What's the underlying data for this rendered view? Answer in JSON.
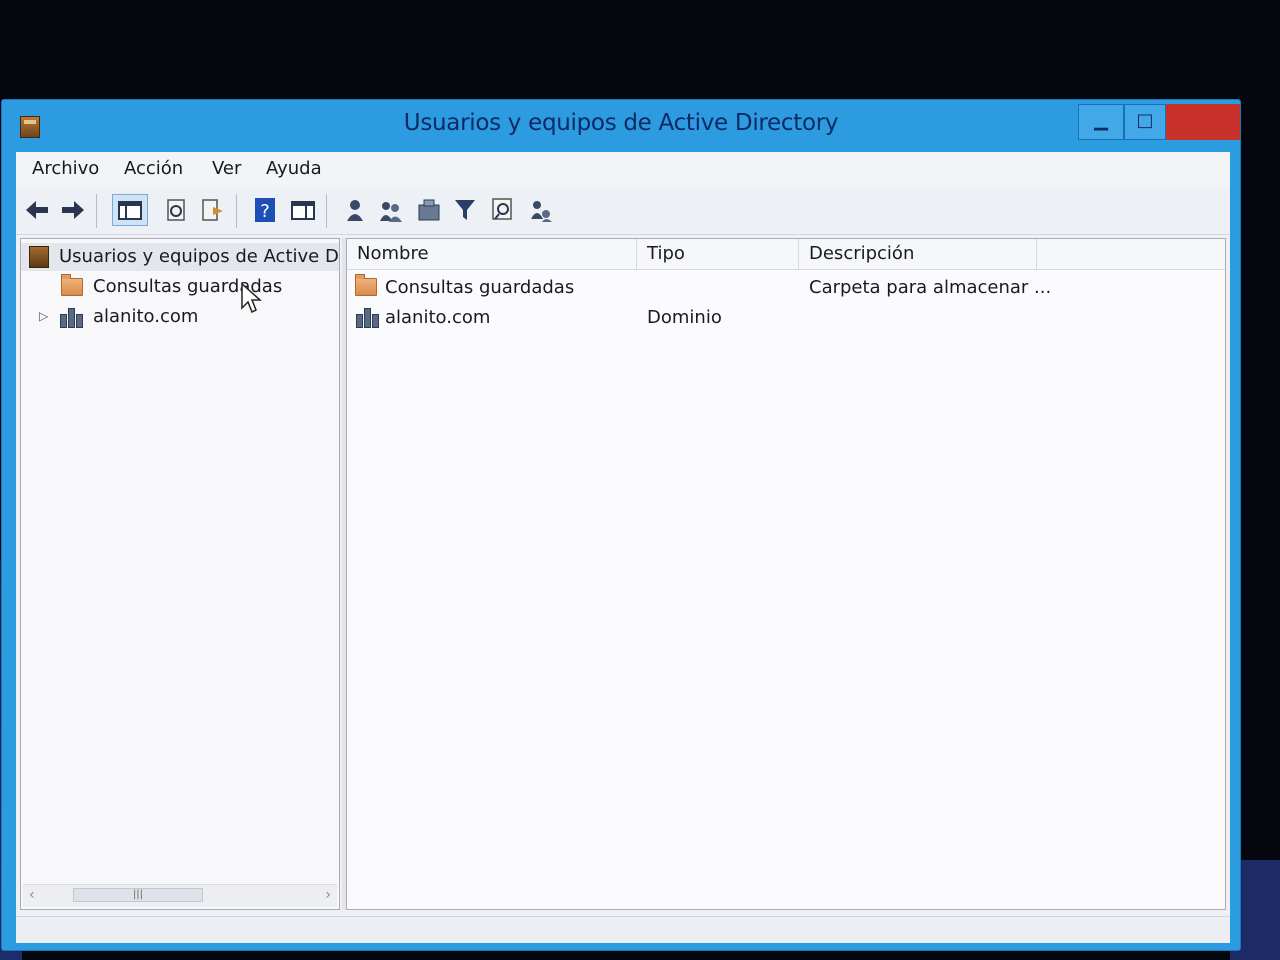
{
  "window": {
    "title": "Usuarios y equipos de Active Directory",
    "controls": {
      "minimize": "▁",
      "maximize": "□",
      "close": ""
    }
  },
  "menu": {
    "items": [
      "Archivo",
      "Acción",
      "Ver",
      "Ayuda"
    ]
  },
  "toolbar": {
    "buttons": [
      {
        "icon": "back-arrow-icon"
      },
      {
        "icon": "forward-arrow-icon"
      },
      {
        "icon": "console-tree-icon",
        "active": true
      },
      {
        "icon": "refresh-icon"
      },
      {
        "icon": "export-list-icon"
      },
      {
        "icon": "help-icon"
      },
      {
        "icon": "show-pane-icon"
      },
      {
        "icon": "new-user-icon"
      },
      {
        "icon": "new-group-icon"
      },
      {
        "icon": "new-ou-icon"
      },
      {
        "icon": "filter-icon"
      },
      {
        "icon": "find-icon"
      },
      {
        "icon": "add-to-group-icon"
      }
    ]
  },
  "tree": {
    "root": "Usuarios y equipos de Active Dir",
    "items": [
      {
        "label": "Consultas guardadas",
        "icon": "folder-icon"
      },
      {
        "label": "alanito.com",
        "icon": "domain-icon",
        "expander": "▷"
      }
    ]
  },
  "list": {
    "columns": [
      "Nombre",
      "Tipo",
      "Descripción"
    ],
    "rows": [
      {
        "name": "Consultas guardadas",
        "type": "",
        "description": "Carpeta para almacenar ...",
        "icon": "folder-icon"
      },
      {
        "name": "alanito.com",
        "type": "Dominio",
        "description": "",
        "icon": "domain-icon"
      }
    ]
  },
  "colors": {
    "titlebar": "#2d9be0",
    "title_text": "#0c2a66",
    "close_button": "#c8312a"
  }
}
